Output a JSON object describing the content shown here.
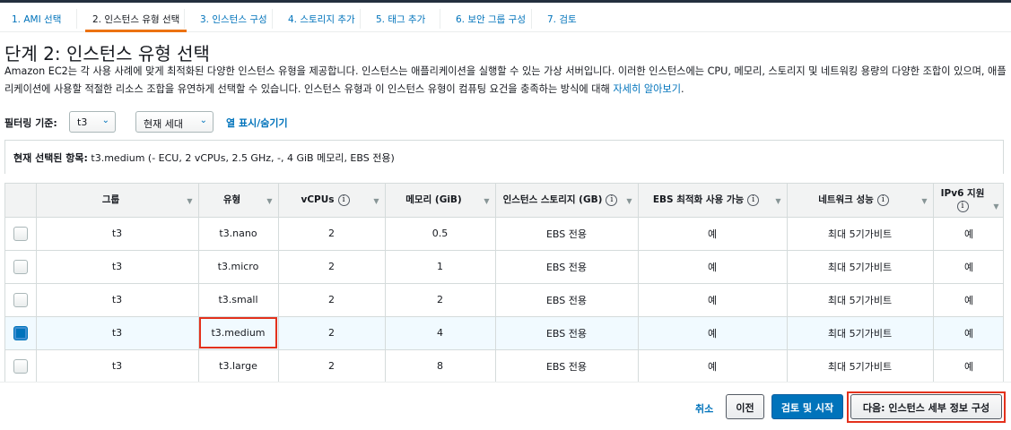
{
  "steps": [
    {
      "label": "1. AMI 선택",
      "active": false
    },
    {
      "label": "2. 인스턴스 유형 선택",
      "active": true
    },
    {
      "label": "3. 인스턴스 구성",
      "active": false
    },
    {
      "label": "4. 스토리지 추가",
      "active": false
    },
    {
      "label": "5. 태그 추가",
      "active": false
    },
    {
      "label": "6. 보안 그룹 구성",
      "active": false
    },
    {
      "label": "7. 검토",
      "active": false
    }
  ],
  "title": "단계 2: 인스턴스 유형 선택",
  "description": "Amazon EC2는 각 사용 사례에 맞게 최적화된 다양한 인스턴스 유형을 제공합니다. 인스턴스는 애플리케이션을 실행할 수 있는 가상 서버입니다. 이러한 인스턴스에는 CPU, 메모리, 스토리지 및 네트워킹 용량의 다양한 조합이 있으며, 애플리케이션에 사용할 적절한 리소스 조합을 유연하게 선택할 수 있습니다. 인스턴스 유형과 이 인스턴스 유형이 컴퓨팅 요건을 충족하는 방식에 대해 ",
  "description_link": "자세히 알아보기",
  "description_end": ".",
  "filter": {
    "label": "필터링 기준:",
    "family_value": "t3",
    "generation_value": "현재 세대",
    "toggle_columns": "열 표시/숨기기"
  },
  "selection": {
    "label": "현재 선택된 항목:",
    "value": "t3.medium (- ECU, 2 vCPUs, 2.5 GHz, -, 4 GiB 메모리, EBS 전용)"
  },
  "columns": [
    "그룹",
    "유형",
    "vCPUs",
    "메모리 (GiB)",
    "인스턴스 스토리지 (GB)",
    "EBS 최적화 사용 가능",
    "네트워크 성능",
    "IPv6 지원"
  ],
  "info_glyph": "i",
  "rows": [
    {
      "group": "t3",
      "type": "t3.nano",
      "vcpus": "2",
      "memory": "0.5",
      "storage": "EBS 전용",
      "ebs": "예",
      "network": "최대 5기가비트",
      "ipv6": "예",
      "selected": false
    },
    {
      "group": "t3",
      "type": "t3.micro",
      "vcpus": "2",
      "memory": "1",
      "storage": "EBS 전용",
      "ebs": "예",
      "network": "최대 5기가비트",
      "ipv6": "예",
      "selected": false
    },
    {
      "group": "t3",
      "type": "t3.small",
      "vcpus": "2",
      "memory": "2",
      "storage": "EBS 전용",
      "ebs": "예",
      "network": "최대 5기가비트",
      "ipv6": "예",
      "selected": false
    },
    {
      "group": "t3",
      "type": "t3.medium",
      "vcpus": "2",
      "memory": "4",
      "storage": "EBS 전용",
      "ebs": "예",
      "network": "최대 5기가비트",
      "ipv6": "예",
      "selected": true
    },
    {
      "group": "t3",
      "type": "t3.large",
      "vcpus": "2",
      "memory": "8",
      "storage": "EBS 전용",
      "ebs": "예",
      "network": "최대 5기가비트",
      "ipv6": "예",
      "selected": false
    }
  ],
  "footer": {
    "cancel": "취소",
    "previous": "이전",
    "review_launch": "검토 및 시작",
    "next": "다음: 인스턴스 세부 정보 구성"
  },
  "colors": {
    "link": "#0073bb",
    "active_tab": "#ec7211",
    "highlight": "#e3311c",
    "primary_button": "#0073bb"
  }
}
